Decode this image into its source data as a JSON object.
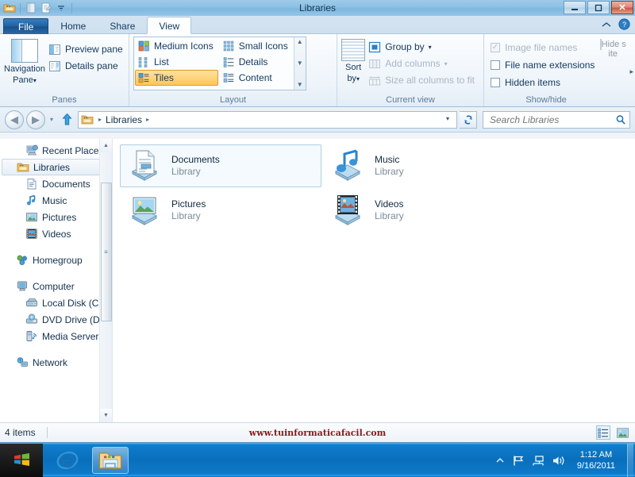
{
  "window": {
    "title": "Libraries",
    "quick_access": [
      "explorer-icon",
      "properties-icon",
      "new-folder-icon",
      "customize-dropdown-icon"
    ],
    "controls": {
      "minimize": "—",
      "maximize": "❐",
      "close": "✕"
    }
  },
  "tabs": [
    {
      "label": "File",
      "active": false,
      "kind": "file"
    },
    {
      "label": "Home",
      "active": false
    },
    {
      "label": "Share",
      "active": false
    },
    {
      "label": "View",
      "active": true
    }
  ],
  "tabstrip_right": {
    "collapse": "⌃",
    "help": "?"
  },
  "ribbon": {
    "groups": [
      {
        "name": "Panes",
        "label": "Panes",
        "big_button": {
          "line1": "Navigation",
          "line2": "Pane",
          "caret": "▾"
        },
        "checks": [
          {
            "label": "Preview pane",
            "icon": "preview-pane-icon"
          },
          {
            "label": "Details pane",
            "icon": "details-pane-icon"
          }
        ]
      },
      {
        "name": "Layout",
        "label": "Layout",
        "items": [
          {
            "label": "Medium Icons",
            "selected": false
          },
          {
            "label": "List",
            "selected": false
          },
          {
            "label": "Tiles",
            "selected": true
          },
          {
            "label": "Small Icons",
            "selected": false
          },
          {
            "label": "Details",
            "selected": false
          },
          {
            "label": "Content",
            "selected": false
          }
        ],
        "scroll": {
          "up": "▲",
          "down": "▼",
          "more": "▼"
        }
      },
      {
        "name": "Current view",
        "label": "Current view",
        "sort_button": {
          "line1": "Sort",
          "line2": "by",
          "caret": "▾"
        },
        "items": [
          {
            "label": "Group by",
            "caret": "▾",
            "disabled": false
          },
          {
            "label": "Add columns",
            "caret": "▾",
            "disabled": true
          },
          {
            "label": "Size all columns to fit",
            "caret": "",
            "disabled": true
          }
        ]
      },
      {
        "name": "Show/hide",
        "label": "Show/hide",
        "checks": [
          {
            "label": "Image file names",
            "checked": true,
            "disabled": true
          },
          {
            "label": "File name extensions",
            "checked": false,
            "disabled": false
          },
          {
            "label": "Hidden items",
            "checked": false,
            "disabled": false
          }
        ],
        "hide_button": {
          "line1": "Hide s",
          "line2": "ite"
        }
      }
    ],
    "overflow_arrow": "▸"
  },
  "addressbar": {
    "back": "◀",
    "forward": "▶",
    "history_caret": "▾",
    "up": "⬆",
    "breadcrumb": {
      "icon": "libraries-folder-icon",
      "sep1": "▸",
      "item": "Libraries",
      "sep2": "▸"
    },
    "dropdown_caret": "▾",
    "refresh": "⟳",
    "search": {
      "placeholder": "Search Libraries",
      "value": "",
      "icon": "search-icon"
    }
  },
  "navpane": {
    "items": [
      {
        "label": "Recent Places",
        "icon": "recent-places-icon",
        "level": 1,
        "selected": false
      },
      {
        "label": "Libraries",
        "icon": "libraries-icon",
        "level": 0,
        "selected": true
      },
      {
        "label": "Documents",
        "icon": "documents-icon",
        "level": 1,
        "selected": false
      },
      {
        "label": "Music",
        "icon": "music-icon",
        "level": 1,
        "selected": false
      },
      {
        "label": "Pictures",
        "icon": "pictures-icon",
        "level": 1,
        "selected": false
      },
      {
        "label": "Videos",
        "icon": "videos-icon",
        "level": 1,
        "selected": false
      },
      {
        "label": "Homegroup",
        "icon": "homegroup-icon",
        "level": 0,
        "selected": false,
        "gap_before": true
      },
      {
        "label": "Computer",
        "icon": "computer-icon",
        "level": 0,
        "selected": false,
        "gap_before": true
      },
      {
        "label": "Local Disk (C:)",
        "icon": "harddisk-icon",
        "level": 1,
        "selected": false
      },
      {
        "label": "DVD Drive (D:) W",
        "icon": "dvd-drive-icon",
        "level": 1,
        "selected": false
      },
      {
        "label": "Media Servers",
        "icon": "media-server-icon",
        "level": 1,
        "selected": false
      },
      {
        "label": "Network",
        "icon": "network-icon",
        "level": 0,
        "selected": false,
        "gap_before": true
      }
    ],
    "scrollbar": {
      "up": "▲",
      "down": "▼",
      "grip": "≡"
    }
  },
  "content": {
    "tiles": [
      {
        "name": "Documents",
        "sub": "Library",
        "icon": "documents-library-icon",
        "selected": true
      },
      {
        "name": "Music",
        "sub": "Library",
        "icon": "music-library-icon",
        "selected": false
      },
      {
        "name": "Pictures",
        "sub": "Library",
        "icon": "pictures-library-icon",
        "selected": false
      },
      {
        "name": "Videos",
        "sub": "Library",
        "icon": "videos-library-icon",
        "selected": false
      }
    ]
  },
  "statusbar": {
    "item_count": "4 items",
    "watermark": "www.tuinformaticafacil.com",
    "view_details_icon": "details-view-icon",
    "view_large_icon": "large-icons-view-icon"
  },
  "taskbar": {
    "start": "start-orb-icon",
    "items": [
      {
        "icon": "internet-explorer-icon",
        "active": false,
        "name": "Internet Explorer"
      },
      {
        "icon": "file-explorer-icon",
        "active": true,
        "name": "File Explorer"
      }
    ],
    "tray": {
      "show_hidden": "▲",
      "icons": [
        "action-center-flag-icon",
        "network-icon",
        "volume-icon"
      ],
      "time": "1:12 AM",
      "date": "9/16/2011"
    }
  },
  "colors": {
    "accent": "#0a7ad6",
    "selection": "#fec65a",
    "watermark": "#8b1a1a",
    "titlebar": "#8cc0e4"
  }
}
